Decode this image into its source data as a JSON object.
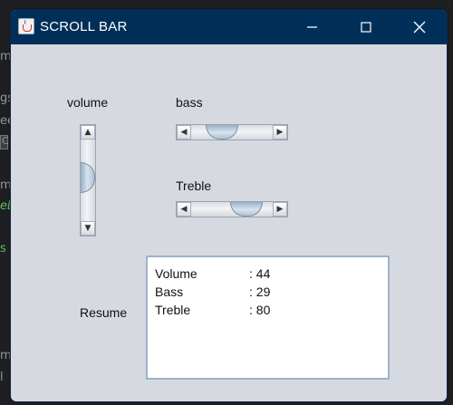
{
  "window": {
    "title": "SCROLL BAR"
  },
  "background_hints": [
    "m",
    "gs",
    "ee",
    "C",
    "m",
    "eL",
    "s",
    "m",
    "l"
  ],
  "labels": {
    "volume": "volume",
    "bass": "bass",
    "treble": "Treble",
    "resume": "Resume"
  },
  "scrollbars": {
    "volume": {
      "value": 44,
      "orientation": "vertical"
    },
    "bass": {
      "value": 29,
      "orientation": "horizontal"
    },
    "treble": {
      "value": 80,
      "orientation": "horizontal"
    }
  },
  "resume_text": {
    "rows": [
      {
        "key": "Volume",
        "value": ": 44"
      },
      {
        "key": "Bass",
        "value": ": 29"
      },
      {
        "key": "Treble",
        "value": ": 80"
      }
    ]
  },
  "colors": {
    "titlebar": "#003059",
    "window_bg": "#d7d9e0",
    "ide_bg": "#1e1f22",
    "thumb": "#b9cbde",
    "textarea_border": "#9cb2cc"
  },
  "icons": [
    "java-cup-icon",
    "minimize-icon",
    "maximize-icon",
    "close-icon",
    "arrow-up-icon",
    "arrow-down-icon",
    "arrow-left-icon",
    "arrow-right-icon"
  ]
}
